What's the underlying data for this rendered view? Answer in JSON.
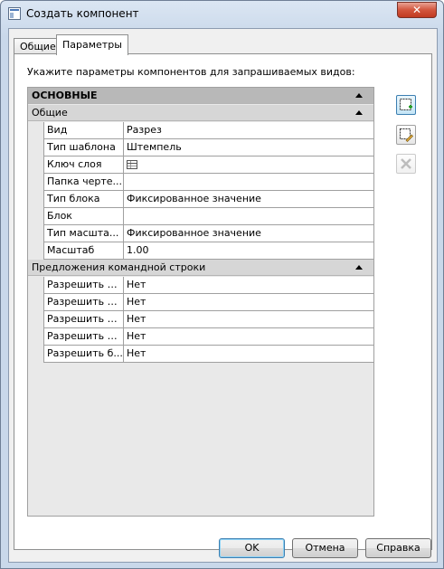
{
  "window": {
    "title": "Создать компонент",
    "close_label": "✕"
  },
  "tabs": [
    {
      "label": "Общие",
      "active": false
    },
    {
      "label": "Параметры",
      "active": true
    }
  ],
  "instruction": "Укажите параметры компонентов для запрашиваемых видов:",
  "grid": {
    "main_category": "ОСНОВНЫЕ",
    "general_category": "Общие",
    "general_rows": [
      {
        "name": "Вид",
        "value": "Разрез"
      },
      {
        "name": "Тип шаблона",
        "value": "Штемпель"
      },
      {
        "name": "Ключ слоя",
        "value": "",
        "icon": "table-icon"
      },
      {
        "name": "Папка черте...",
        "value": ""
      },
      {
        "name": "Тип блока",
        "value": "Фиксированное значение"
      },
      {
        "name": "Блок",
        "value": ""
      },
      {
        "name": "Тип масшта...",
        "value": "Фиксированное значение"
      },
      {
        "name": "Масштаб",
        "value": "1.00"
      }
    ],
    "command_category": "Предложения командной строки",
    "command_rows": [
      {
        "name": "Разрешить м...",
        "value": "Нет"
      },
      {
        "name": "Разрешить п...",
        "value": "Нет"
      },
      {
        "name": "Разрешить р...",
        "value": "Нет"
      },
      {
        "name": "Разрешить р...",
        "value": "Нет"
      },
      {
        "name": "Разрешить б...",
        "value": "Нет"
      }
    ]
  },
  "side_buttons": [
    {
      "icon": "add-component-icon",
      "enabled": true
    },
    {
      "icon": "edit-component-icon",
      "enabled": true
    },
    {
      "icon": "delete-component-icon",
      "enabled": false
    }
  ],
  "buttons": {
    "ok": "OK",
    "cancel": "Отмена",
    "help": "Справка"
  },
  "colors": {
    "accent": "#3c7fb1",
    "category_bg": "#d6d6d6",
    "main_category_bg": "#b8b8b8"
  }
}
